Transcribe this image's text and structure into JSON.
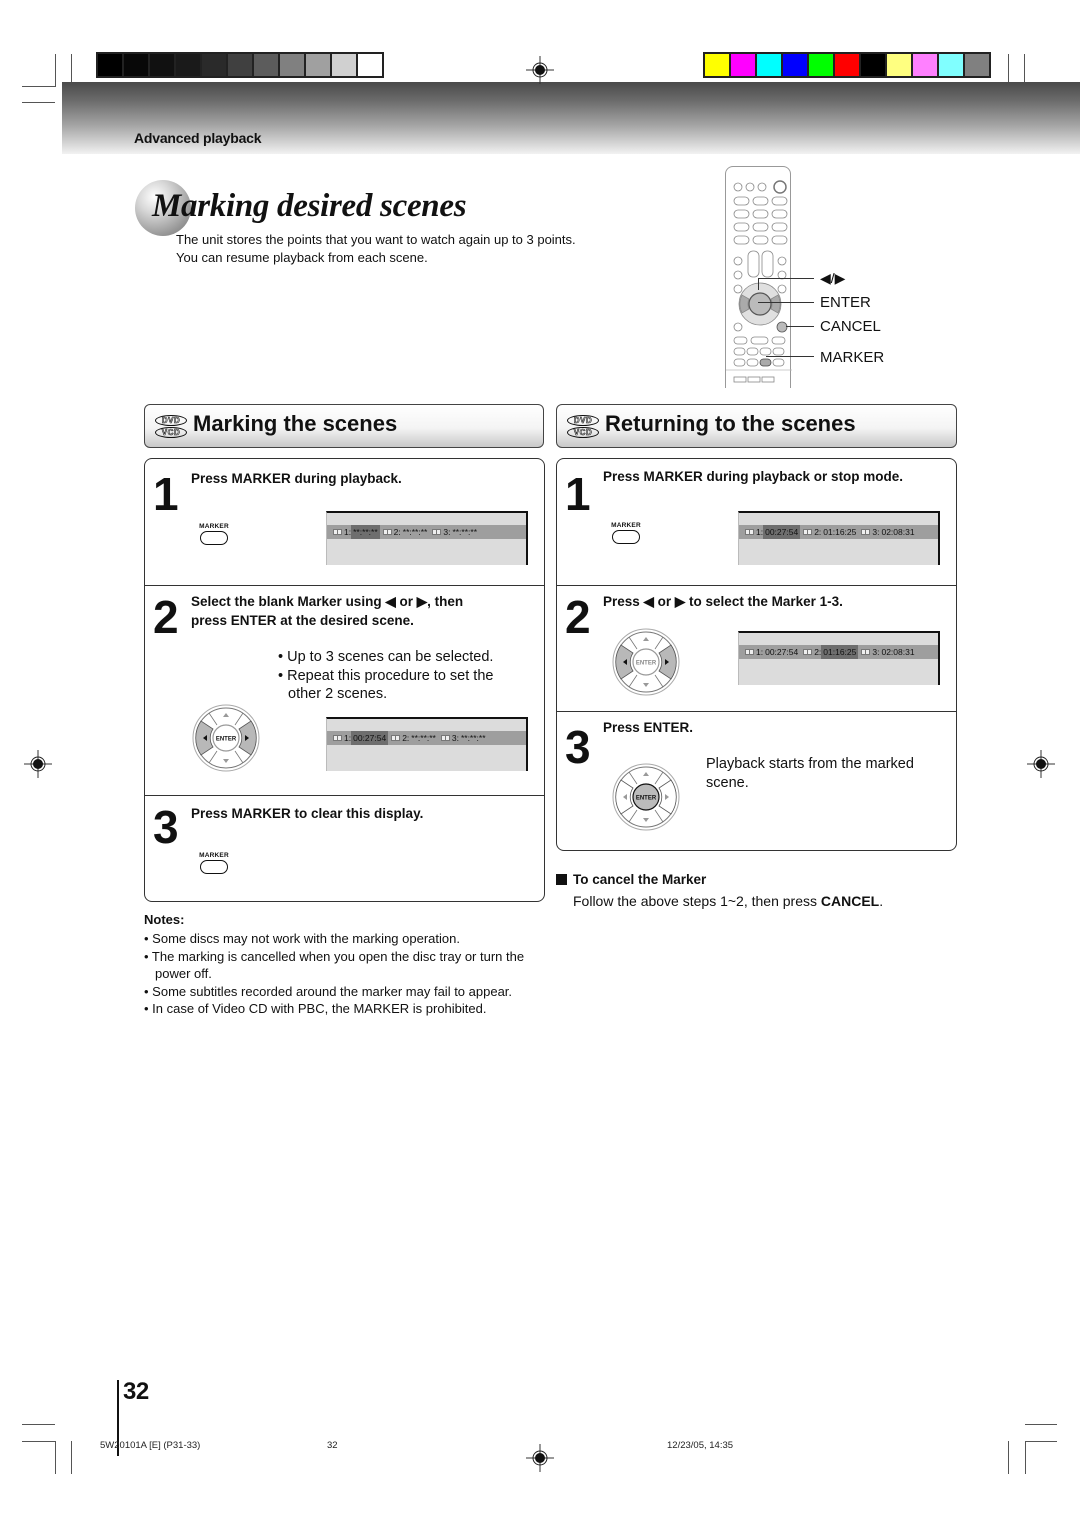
{
  "calibration": {
    "gray_swatches": [
      "#000000",
      "#080808",
      "#111111",
      "#1a1a1a",
      "#2a2a2a",
      "#404040",
      "#5c5c5c",
      "#808080",
      "#a0a0a0",
      "#d0d0d0",
      "#ffffff"
    ],
    "color_swatches": [
      "#ffff00",
      "#ff00ff",
      "#00ffff",
      "#0000ff",
      "#00ff00",
      "#ff0000",
      "#000000",
      "#ffff80",
      "#ff80ff",
      "#80ffff",
      "#808080"
    ]
  },
  "header": {
    "section": "Advanced playback"
  },
  "title": {
    "text": "Marking desired scenes",
    "intro_line1": "The unit stores the points that you want to watch again up to 3 points.",
    "intro_line2": "You can resume playback from each scene."
  },
  "remote": {
    "labels": {
      "arrows": "◀/▶",
      "enter": "ENTER",
      "cancel": "CANCEL",
      "marker": "MARKER"
    }
  },
  "badges": {
    "dvd": "DVD",
    "vcd": "VCD"
  },
  "marking": {
    "title": "Marking the scenes",
    "steps": [
      {
        "num": "1",
        "text": "Press MARKER during playback.",
        "button_label": "MARKER",
        "osd": [
          {
            "label": "1:",
            "value": "**:**:**",
            "selected": true
          },
          {
            "label": "2:",
            "value": "**:**:**",
            "selected": false
          },
          {
            "label": "3:",
            "value": "**:**:**",
            "selected": false
          }
        ]
      },
      {
        "num": "2",
        "text_line1": "Select the blank Marker using ◀ or ▶, then",
        "text_line2": "press ENTER at the desired scene.",
        "bullets": [
          "• Up to 3 scenes can be selected.",
          "• Repeat this procedure to set the",
          "other 2 scenes."
        ],
        "dpad_label": "ENTER",
        "osd": [
          {
            "label": "1:",
            "value": "00:27:54",
            "selected": true
          },
          {
            "label": "2:",
            "value": "**:**:**",
            "selected": false
          },
          {
            "label": "3:",
            "value": "**:**:**",
            "selected": false
          }
        ]
      },
      {
        "num": "3",
        "text": "Press MARKER to clear this display.",
        "button_label": "MARKER"
      }
    ]
  },
  "returning": {
    "title": "Returning to the scenes",
    "steps": [
      {
        "num": "1",
        "text": "Press MARKER during playback or stop mode.",
        "button_label": "MARKER",
        "osd": [
          {
            "label": "1:",
            "value": "00:27:54",
            "selected": true
          },
          {
            "label": "2:",
            "value": "01:16:25",
            "selected": false
          },
          {
            "label": "3:",
            "value": "02:08:31",
            "selected": false
          }
        ]
      },
      {
        "num": "2",
        "text": "Press ◀ or ▶ to select the Marker 1-3.",
        "dpad_label": "ENTER",
        "osd": [
          {
            "label": "1:",
            "value": "00:27:54",
            "selected": false
          },
          {
            "label": "2:",
            "value": "01:16:25",
            "selected": true
          },
          {
            "label": "3:",
            "value": "02:08:31",
            "selected": false
          }
        ]
      },
      {
        "num": "3",
        "text": "Press ENTER.",
        "dpad_label": "ENTER",
        "body_line1": "Playback starts from the marked",
        "body_line2": "scene."
      }
    ]
  },
  "cancel": {
    "heading": "To cancel the Marker",
    "body_prefix": "Follow the above steps 1~2, then press ",
    "body_bold": "CANCEL",
    "body_suffix": "."
  },
  "notes": {
    "heading": "Notes:",
    "items": [
      "• Some discs may not work with the marking operation.",
      "• The marking is cancelled when you open the disc tray or turn the power off.",
      "• Some subtitles recorded around the marker may fail to appear.",
      "• In case of Video CD with PBC, the MARKER is prohibited."
    ]
  },
  "page": {
    "number": "32",
    "footer_code": "5W20101A [E] (P31-33)",
    "footer_page": "32",
    "footer_date": "12/23/05, 14:35"
  }
}
